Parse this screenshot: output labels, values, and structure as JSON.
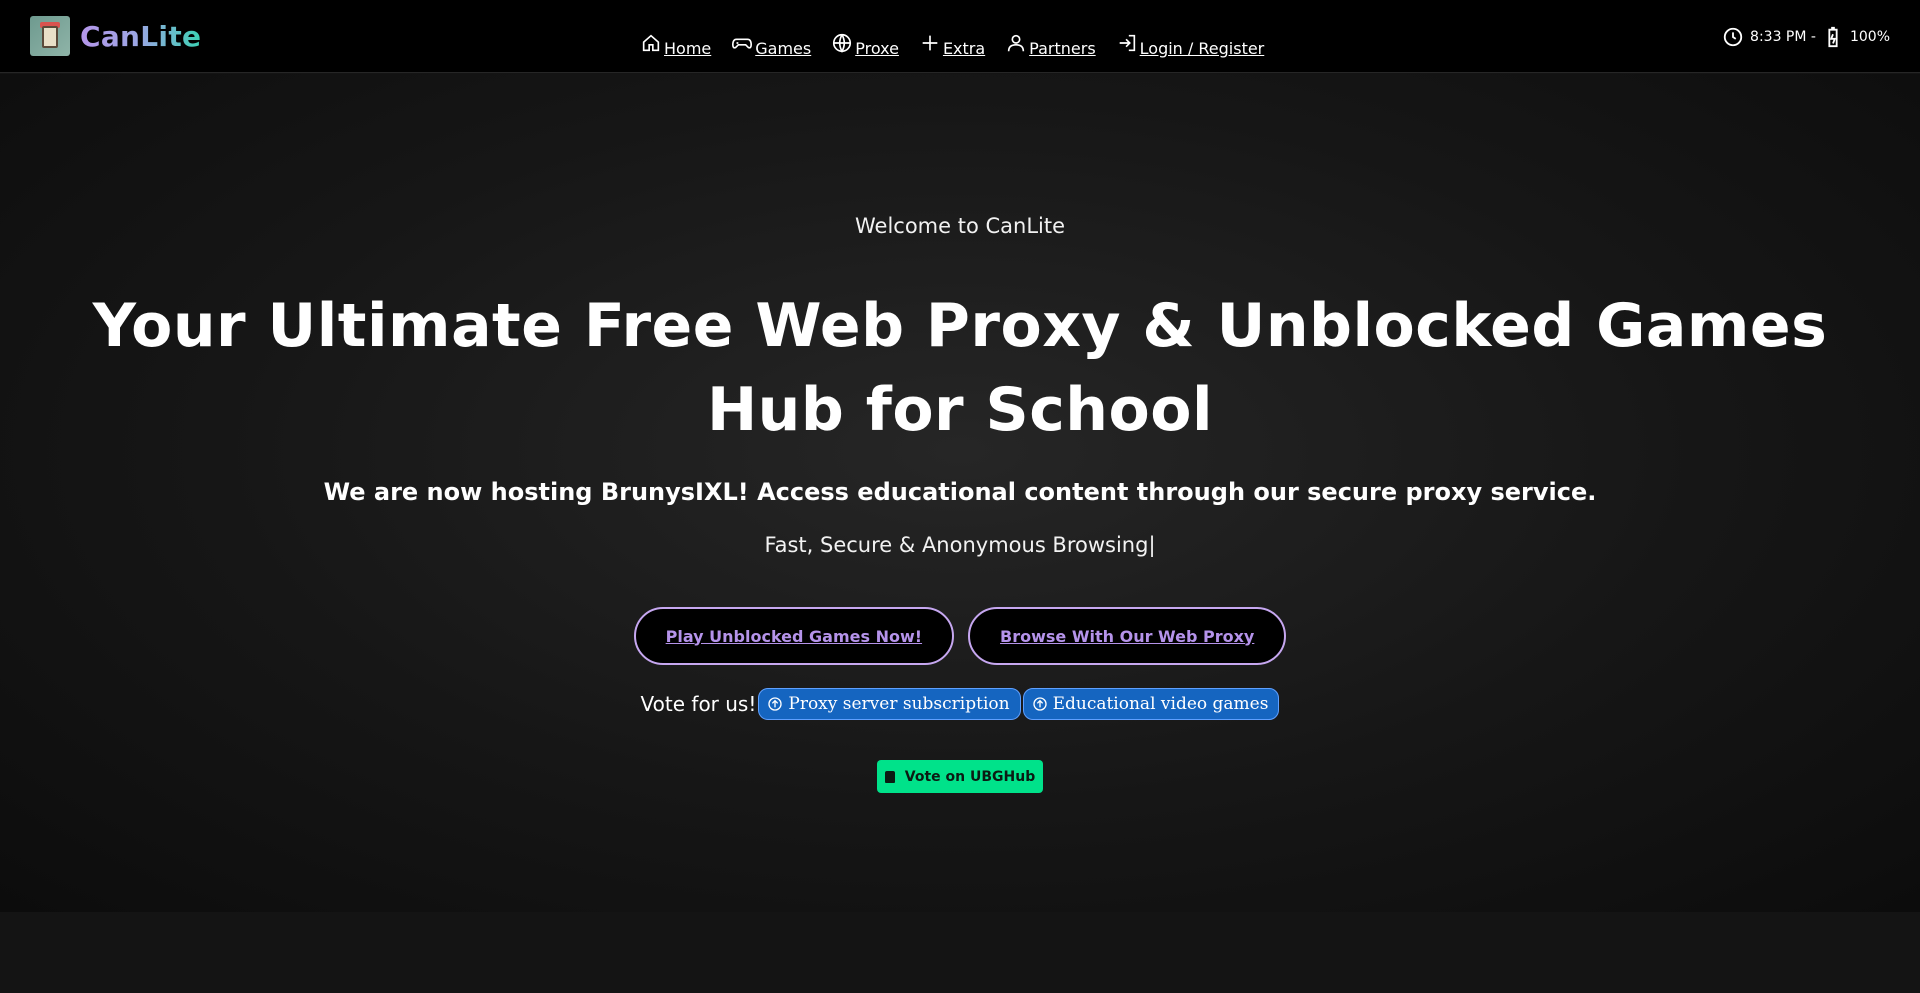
{
  "brand": {
    "name": "CanLite",
    "logo_icon": "can-logo-icon"
  },
  "nav": {
    "items": [
      {
        "label": " Home",
        "icon": "home-icon"
      },
      {
        "label": " Games",
        "icon": "gamepad-icon"
      },
      {
        "label": " Proxe",
        "icon": "globe-icon"
      },
      {
        "label": " Extra",
        "icon": "plus-icon"
      },
      {
        "label": "Partners",
        "icon": "user-icon"
      },
      {
        "label": "Login / Register",
        "icon": "login-icon"
      }
    ]
  },
  "status": {
    "time": "8:33 PM -",
    "battery": "100%"
  },
  "hero": {
    "welcome": "Welcome to CanLite",
    "headline": "Your Ultimate Free Web Proxy & Unblocked Games Hub for School",
    "sub": "We are now hosting BrunysIXL! Access educational content through our secure proxy service.",
    "typed": "Fast, Secure & Anonymous Browsing|",
    "cta_games": "Play Unblocked Games Now!",
    "cta_proxy": "Browse With Our Web Proxy",
    "vote_label": "Vote for us!",
    "vote_chips": [
      "Proxy server subscription",
      "Educational video games"
    ],
    "ubg_button": "Vote on UBGHub"
  },
  "colors": {
    "accent_purple": "#b593ea",
    "accent_teal": "#3bd1b4",
    "chip_blue": "#1565c0",
    "ubg_green": "#00e28a"
  }
}
